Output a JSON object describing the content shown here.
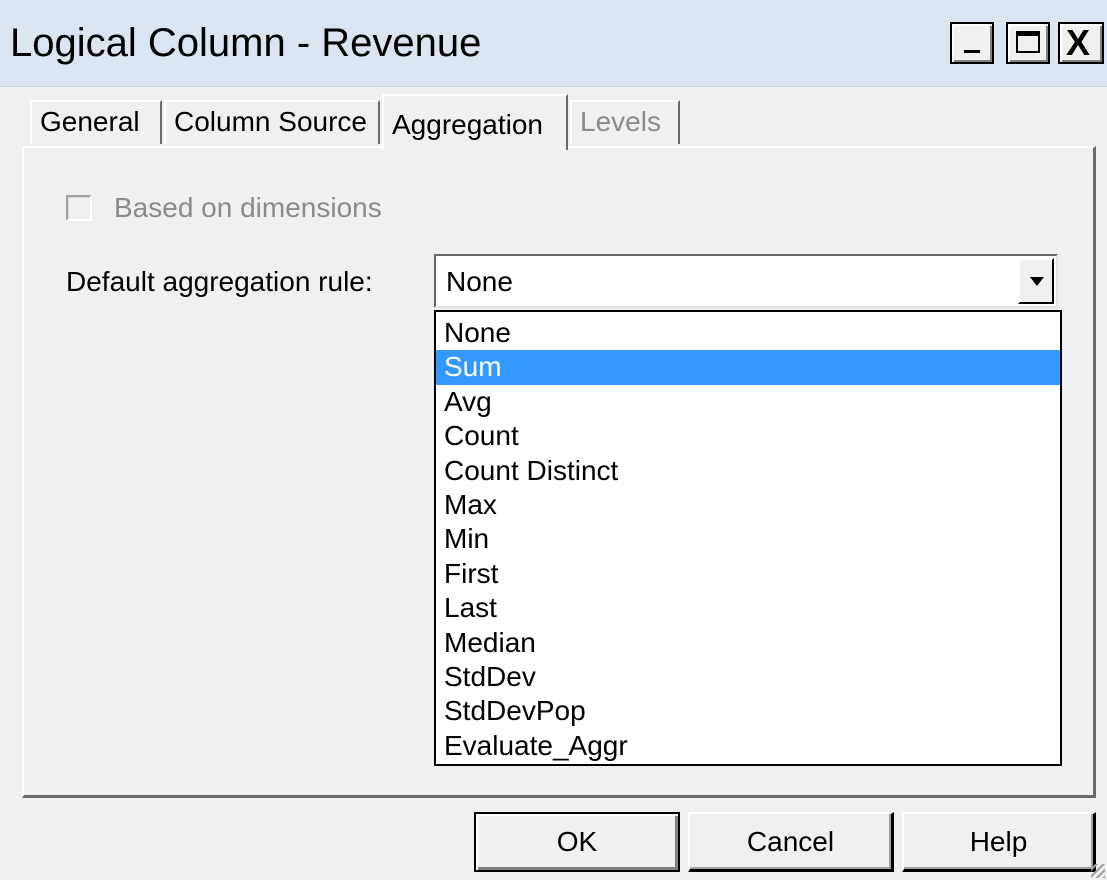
{
  "window": {
    "title": "Logical Column - Revenue"
  },
  "title_buttons": {
    "minimize_icon": "minimize-icon",
    "maximize_icon": "maximize-icon",
    "close_icon": "close-icon",
    "close_glyph": "X"
  },
  "tabs": [
    {
      "label": "General",
      "state": "normal"
    },
    {
      "label": "Column Source",
      "state": "normal"
    },
    {
      "label": "Aggregation",
      "state": "active"
    },
    {
      "label": "Levels",
      "state": "disabled"
    }
  ],
  "aggregation": {
    "based_on_dimensions_label": "Based on dimensions",
    "based_on_dimensions_checked": false,
    "default_rule_label": "Default aggregation rule:",
    "default_rule_value": "None",
    "options": [
      "None",
      "Sum",
      "Avg",
      "Count",
      "Count Distinct",
      "Max",
      "Min",
      "First",
      "Last",
      "Median",
      "StdDev",
      "StdDevPop",
      "Evaluate_Aggr"
    ],
    "highlighted_option": "Sum"
  },
  "buttons": {
    "ok": "OK",
    "cancel": "Cancel",
    "help": "Help"
  },
  "colors": {
    "highlight": "#3399ff",
    "titlebar": "#dbe5f1",
    "face": "#f0f0f0",
    "disabled_text": "#8a8a8a"
  }
}
